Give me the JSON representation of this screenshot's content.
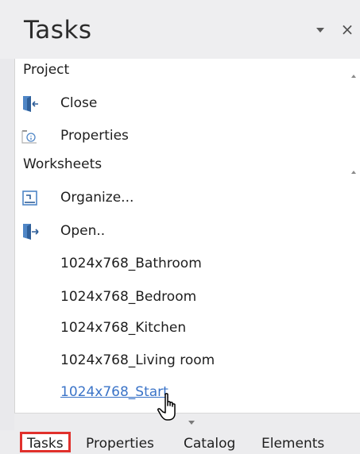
{
  "panel": {
    "title": "Tasks"
  },
  "sections": [
    {
      "header": "Project",
      "items": [
        {
          "label": "Close",
          "icon": "close-document-icon"
        },
        {
          "label": "Properties",
          "icon": "properties-icon"
        }
      ]
    },
    {
      "header": "Worksheets",
      "items": [
        {
          "label": "Organize...",
          "icon": "organize-icon"
        },
        {
          "label": "Open..",
          "icon": "open-document-icon"
        },
        {
          "label": "1024x768_Bathroom"
        },
        {
          "label": "1024x768_Bedroom"
        },
        {
          "label": "1024x768_Kitchen"
        },
        {
          "label": "1024x768_Living room"
        },
        {
          "label": "1024x768_Start",
          "state": "hovered"
        }
      ]
    }
  ],
  "tabs": [
    "Tasks",
    "Properties",
    "Catalog",
    "Elements"
  ],
  "active_tab": "Tasks",
  "colors": {
    "link": "#3b74c8",
    "active_tab_border": "#e0302c",
    "icon_blue": "#4f86c6"
  }
}
